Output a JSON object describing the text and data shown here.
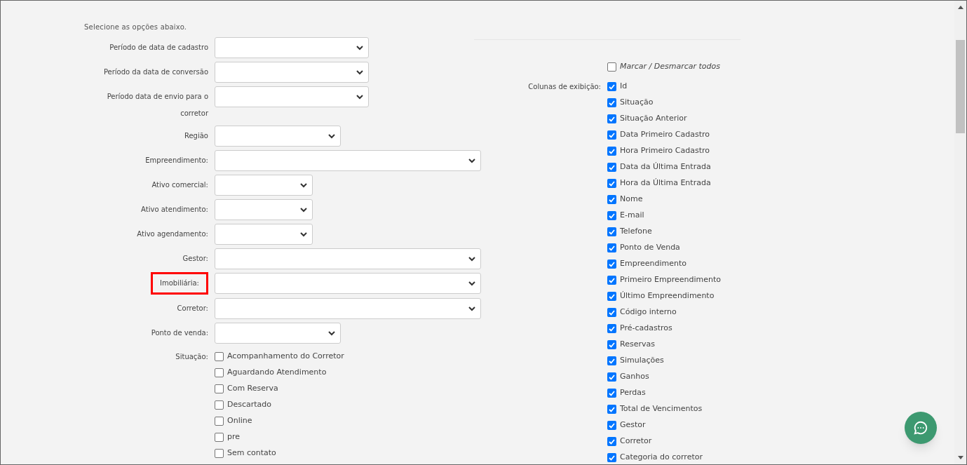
{
  "intro": "Selecione as opções abaixo.",
  "fields": [
    {
      "label": "Período de data de cadastro",
      "highlighted": false
    },
    {
      "label": "Período da data de conversão",
      "highlighted": false
    },
    {
      "label": "Período data de envio para o corretor",
      "highlighted": false
    },
    {
      "label": "Região",
      "highlighted": false
    },
    {
      "label": "Empreendimento:",
      "highlighted": false
    },
    {
      "label": "Ativo comercial:",
      "highlighted": false
    },
    {
      "label": "Ativo atendimento:",
      "highlighted": false
    },
    {
      "label": "Ativo agendamento:",
      "highlighted": false
    },
    {
      "label": "Gestor:",
      "highlighted": false
    },
    {
      "label": "Imobiliária:",
      "highlighted": true
    },
    {
      "label": "Corretor:",
      "highlighted": false
    },
    {
      "label": "Ponto de venda:",
      "highlighted": false
    }
  ],
  "situacao": {
    "label": "Situação:",
    "options": [
      {
        "label": "Acompanhamento do Corretor",
        "checked": false
      },
      {
        "label": "Aguardando Atendimento",
        "checked": false
      },
      {
        "label": "Com Reserva",
        "checked": false
      },
      {
        "label": "Descartado",
        "checked": false
      },
      {
        "label": "Online",
        "checked": false
      },
      {
        "label": "pre",
        "checked": false
      },
      {
        "label": "Sem contato",
        "checked": false
      }
    ]
  },
  "columns": {
    "toggle_all": {
      "label": "Marcar / Desmarcar todos",
      "checked": false
    },
    "label": "Colunas de exibição:",
    "options": [
      {
        "label": "Id",
        "checked": true
      },
      {
        "label": "Situação",
        "checked": true
      },
      {
        "label": "Situação Anterior",
        "checked": true
      },
      {
        "label": "Data Primeiro Cadastro",
        "checked": true
      },
      {
        "label": "Hora Primeiro Cadastro",
        "checked": true
      },
      {
        "label": "Data da Última Entrada",
        "checked": true
      },
      {
        "label": "Hora da Última Entrada",
        "checked": true
      },
      {
        "label": "Nome",
        "checked": true
      },
      {
        "label": "E-mail",
        "checked": true
      },
      {
        "label": "Telefone",
        "checked": true
      },
      {
        "label": "Ponto de Venda",
        "checked": true
      },
      {
        "label": "Empreendimento",
        "checked": true
      },
      {
        "label": "Primeiro Empreendimento",
        "checked": true
      },
      {
        "label": "Último Empreendimento",
        "checked": true
      },
      {
        "label": "Código interno",
        "checked": true
      },
      {
        "label": "Pré-cadastros",
        "checked": true
      },
      {
        "label": "Reservas",
        "checked": true
      },
      {
        "label": "Simulações",
        "checked": true
      },
      {
        "label": "Ganhos",
        "checked": true
      },
      {
        "label": "Perdas",
        "checked": true
      },
      {
        "label": "Total de Vencimentos",
        "checked": true
      },
      {
        "label": "Gestor",
        "checked": true
      },
      {
        "label": "Corretor",
        "checked": true
      },
      {
        "label": "Categoria do corretor",
        "checked": true
      }
    ]
  }
}
